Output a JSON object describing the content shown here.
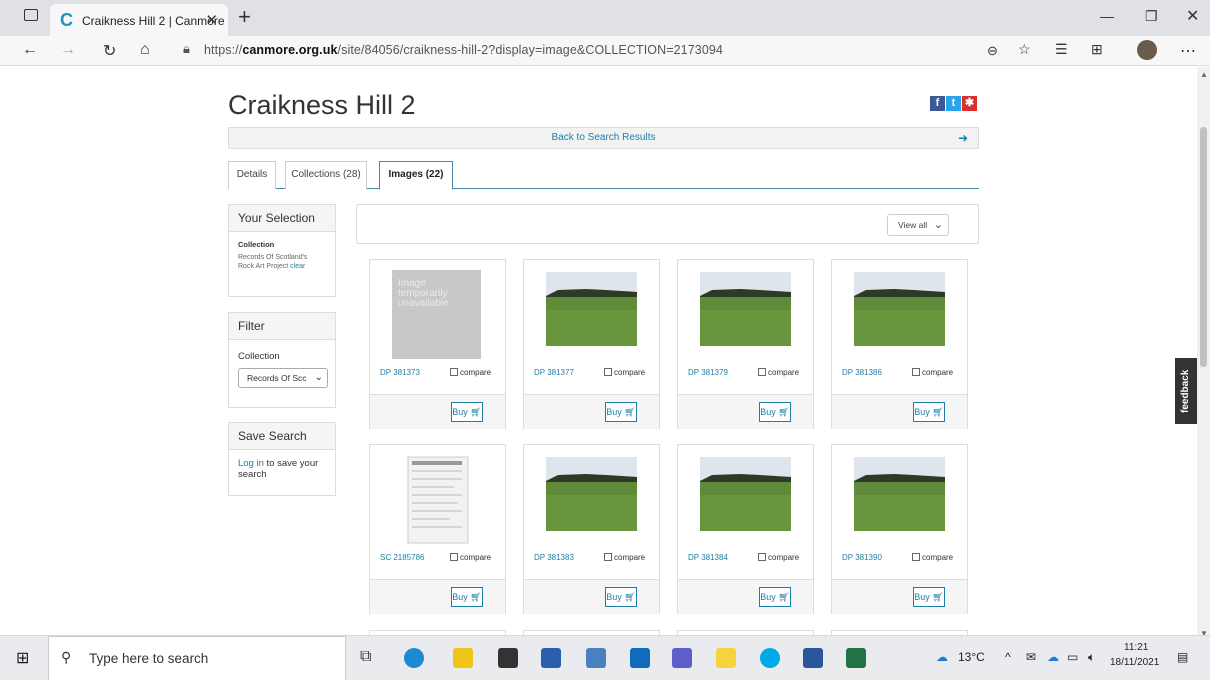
{
  "browser": {
    "tab_title": "Craikness Hill 2 | Canmore",
    "url_prefix": "https://",
    "url_host": "canmore.org.uk",
    "url_path": "/site/84056/craikness-hill-2?display=image&COLLECTION=2173094"
  },
  "page": {
    "title": "Craikness Hill 2",
    "back_link": "Back to Search Results",
    "tabs": [
      "Details",
      "Collections (28)",
      "Images (22)"
    ],
    "active_tab": "Images (22)"
  },
  "sidebar": {
    "selection": {
      "heading": "Your Selection",
      "label": "Collection",
      "value": "Records Of Scotland's Rock Art Project",
      "clear": "clear"
    },
    "filter": {
      "heading": "Filter",
      "label": "Collection",
      "selected": "Records Of Scc"
    },
    "save": {
      "heading": "Save Search",
      "login": "Log in",
      "text": " to save your search"
    }
  },
  "gallery": {
    "view_select": "View all",
    "compare_label": "compare",
    "buy_label": "Buy",
    "unavailable_text": "Image temporarily unavailable",
    "cards": [
      {
        "ref": "DP 381373",
        "image": "unavailable"
      },
      {
        "ref": "DP 381377",
        "image": "field-photo"
      },
      {
        "ref": "DP 381379",
        "image": "field-photo"
      },
      {
        "ref": "DP 381386",
        "image": "field-photo"
      },
      {
        "ref": "SC 2185786",
        "image": "document-scan"
      },
      {
        "ref": "DP 381383",
        "image": "field-photo"
      },
      {
        "ref": "DP 381384",
        "image": "field-photo"
      },
      {
        "ref": "DP 381390",
        "image": "field-photo"
      }
    ]
  },
  "feedback_tab": "feedback",
  "taskbar": {
    "search_placeholder": "Type here to search",
    "weather": "13°C",
    "time": "11:21",
    "date": "18/11/2021"
  }
}
